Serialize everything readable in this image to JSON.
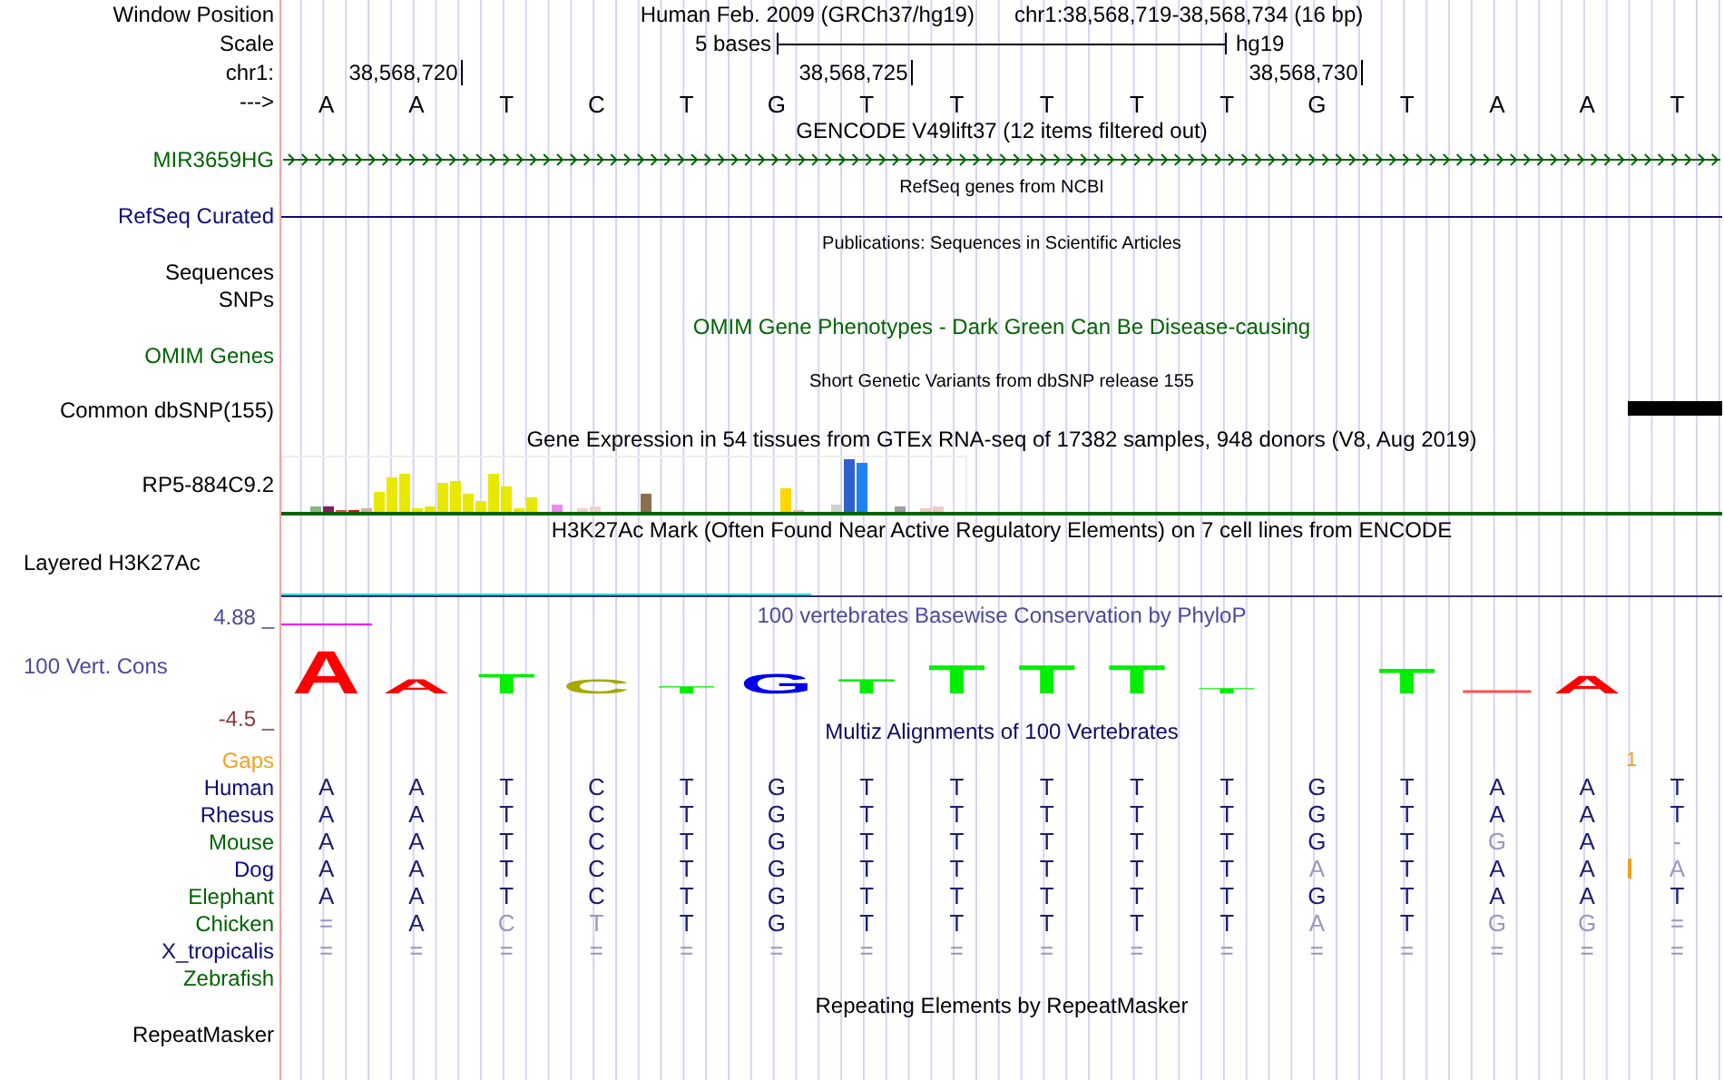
{
  "header": {
    "position_label": "Window Position",
    "assembly_title": "Human Feb. 2009 (GRCh37/hg19)",
    "position": "chr1:38,568,719-38,568,734 (16 bp)",
    "scale_label": "Scale",
    "scale_text": "5 bases",
    "assembly": "hg19",
    "chrom_label": "chr1:",
    "ticks": [
      "38,568,720",
      "38,568,725",
      "38,568,730"
    ],
    "strand_label": "--->",
    "bases": [
      "A",
      "A",
      "T",
      "C",
      "T",
      "G",
      "T",
      "T",
      "T",
      "T",
      "T",
      "G",
      "T",
      "A",
      "A",
      "T"
    ]
  },
  "rows": [
    {
      "kind": "title",
      "text": "GENCODE V49lift37 (12 items filtered out)",
      "color": "#000000"
    },
    {
      "kind": "gene",
      "label": "MIR3659HG",
      "color": "#006400"
    },
    {
      "kind": "subtitle",
      "text": "RefSeq genes from NCBI",
      "color": "#000000"
    },
    {
      "kind": "line",
      "label": "RefSeq Curated",
      "color": "#0c0c78"
    },
    {
      "kind": "subtitle",
      "text": "Publications: Sequences in Scientific Articles",
      "color": "#000000"
    },
    {
      "kind": "label",
      "label": "Sequences",
      "color": "#000000"
    },
    {
      "kind": "label",
      "label": "SNPs",
      "color": "#000000"
    },
    {
      "kind": "title",
      "text": "OMIM Gene Phenotypes - Dark Green Can Be Disease-causing",
      "color": "#006400"
    },
    {
      "kind": "label",
      "label": "OMIM Genes",
      "color": "#006400"
    },
    {
      "kind": "subtitle",
      "text": "Short Genetic Variants from dbSNP release 155",
      "color": "#000000"
    },
    {
      "kind": "variants",
      "label": "Common dbSNP(155)",
      "color": "#000000"
    },
    {
      "kind": "title",
      "text": "Gene Expression in 54 tissues from GTEx RNA-seq of 17382 samples, 948 donors (V8, Aug 2019)",
      "color": "#000000"
    },
    {
      "kind": "expression",
      "label": "RP5-884C9.2",
      "color": "#000000"
    },
    {
      "kind": "title",
      "text": "H3K27Ac Mark (Often Found Near Active Regulatory Elements) on 7 cell lines from ENCODE",
      "color": "#000000"
    },
    {
      "kind": "layered",
      "label": "Layered H3K27Ac",
      "color": "#000000"
    },
    {
      "kind": "phylop",
      "label": "100 Vert. Cons",
      "color": "#4a4a9a",
      "max": "4.88 _",
      "min": "-4.5 _",
      "text": "100 vertebrates Basewise Conservation by PhyloP",
      "logo": [
        {
          "letter": "A",
          "color": "#ff0000"
        },
        {
          "letter": "A",
          "color": "#ff0000"
        },
        {
          "letter": "T",
          "color": "#00ee00"
        },
        {
          "letter": "C",
          "color": "#a8a800"
        },
        {
          "letter": "T",
          "color": "#00ee00"
        },
        {
          "letter": "G",
          "color": "#0000ee"
        },
        {
          "letter": "T",
          "color": "#00ee00"
        },
        {
          "letter": "T",
          "color": "#00ee00"
        },
        {
          "letter": "T",
          "color": "#00ee00"
        },
        {
          "letter": "T",
          "color": "#00ee00"
        },
        {
          "letter": "T",
          "color": "#00ee00"
        },
        {
          "letter": "T",
          "color": "#00ee00"
        },
        {
          "letter": "A",
          "color": "#ff0000"
        }
      ]
    },
    {
      "kind": "title",
      "text": "Multiz Alignments of 100 Vertebrates",
      "color": "#0c0c60"
    },
    {
      "kind": "gaps",
      "label": "Gaps",
      "color": "#f0a020",
      "count": "1"
    },
    {
      "kind": "species",
      "label": "Human",
      "color": "#0c0c78",
      "bases": [
        {
          "text": "A",
          "dim": false
        },
        {
          "text": "A",
          "dim": false
        },
        {
          "text": "T",
          "dim": false
        },
        {
          "text": "C",
          "dim": false
        },
        {
          "text": "T",
          "dim": false
        },
        {
          "text": "G",
          "dim": false
        },
        {
          "text": "T",
          "dim": false
        },
        {
          "text": "T",
          "dim": false
        },
        {
          "text": "T",
          "dim": false
        },
        {
          "text": "T",
          "dim": false
        },
        {
          "text": "T",
          "dim": false
        },
        {
          "text": "G",
          "dim": false
        },
        {
          "text": "T",
          "dim": false
        },
        {
          "text": "A",
          "dim": false
        },
        {
          "text": "A",
          "dim": false
        },
        {
          "text": "T",
          "dim": false
        }
      ]
    },
    {
      "kind": "species",
      "label": "Rhesus",
      "color": "#0c0c78",
      "bases": [
        {
          "text": "A",
          "dim": false
        },
        {
          "text": "A",
          "dim": false
        },
        {
          "text": "T",
          "dim": false
        },
        {
          "text": "C",
          "dim": false
        },
        {
          "text": "T",
          "dim": false
        },
        {
          "text": "G",
          "dim": false
        },
        {
          "text": "T",
          "dim": false
        },
        {
          "text": "T",
          "dim": false
        },
        {
          "text": "T",
          "dim": false
        },
        {
          "text": "T",
          "dim": false
        },
        {
          "text": "T",
          "dim": false
        },
        {
          "text": "G",
          "dim": false
        },
        {
          "text": "T",
          "dim": false
        },
        {
          "text": "A",
          "dim": false
        },
        {
          "text": "A",
          "dim": false
        },
        {
          "text": "T",
          "dim": false
        }
      ]
    },
    {
      "kind": "species",
      "label": "Mouse",
      "color": "#006400",
      "bases": [
        {
          "text": "A",
          "dim": false
        },
        {
          "text": "A",
          "dim": false
        },
        {
          "text": "T",
          "dim": false
        },
        {
          "text": "C",
          "dim": false
        },
        {
          "text": "T",
          "dim": false
        },
        {
          "text": "G",
          "dim": false
        },
        {
          "text": "T",
          "dim": false
        },
        {
          "text": "T",
          "dim": false
        },
        {
          "text": "T",
          "dim": false
        },
        {
          "text": "T",
          "dim": false
        },
        {
          "text": "T",
          "dim": false
        },
        {
          "text": "G",
          "dim": false
        },
        {
          "text": "T",
          "dim": false
        },
        {
          "text": "G",
          "dim": true
        },
        {
          "text": "A",
          "dim": false
        },
        {
          "text": "-",
          "dim": true
        }
      ]
    },
    {
      "kind": "species",
      "label": "Dog",
      "color": "#0c0c78",
      "insertion": true,
      "bases": [
        {
          "text": "A",
          "dim": false
        },
        {
          "text": "A",
          "dim": false
        },
        {
          "text": "T",
          "dim": false
        },
        {
          "text": "C",
          "dim": false
        },
        {
          "text": "T",
          "dim": false
        },
        {
          "text": "G",
          "dim": false
        },
        {
          "text": "T",
          "dim": false
        },
        {
          "text": "T",
          "dim": false
        },
        {
          "text": "T",
          "dim": false
        },
        {
          "text": "T",
          "dim": false
        },
        {
          "text": "T",
          "dim": false
        },
        {
          "text": "A",
          "dim": true
        },
        {
          "text": "T",
          "dim": false
        },
        {
          "text": "A",
          "dim": false
        },
        {
          "text": "A",
          "dim": false
        },
        {
          "text": "A",
          "dim": true
        }
      ]
    },
    {
      "kind": "species",
      "label": "Elephant",
      "color": "#006400",
      "bases": [
        {
          "text": "A",
          "dim": false
        },
        {
          "text": "A",
          "dim": false
        },
        {
          "text": "T",
          "dim": false
        },
        {
          "text": "C",
          "dim": false
        },
        {
          "text": "T",
          "dim": false
        },
        {
          "text": "G",
          "dim": false
        },
        {
          "text": "T",
          "dim": false
        },
        {
          "text": "T",
          "dim": false
        },
        {
          "text": "T",
          "dim": false
        },
        {
          "text": "T",
          "dim": false
        },
        {
          "text": "T",
          "dim": false
        },
        {
          "text": "G",
          "dim": false
        },
        {
          "text": "T",
          "dim": false
        },
        {
          "text": "A",
          "dim": false
        },
        {
          "text": "A",
          "dim": false
        },
        {
          "text": "T",
          "dim": false
        }
      ]
    },
    {
      "kind": "species",
      "label": "Chicken",
      "color": "#006400",
      "bases": [
        {
          "text": "=",
          "dim": true
        },
        {
          "text": "A",
          "dim": false
        },
        {
          "text": "C",
          "dim": true
        },
        {
          "text": "T",
          "dim": true
        },
        {
          "text": "T",
          "dim": false
        },
        {
          "text": "G",
          "dim": false
        },
        {
          "text": "T",
          "dim": false
        },
        {
          "text": "T",
          "dim": false
        },
        {
          "text": "T",
          "dim": false
        },
        {
          "text": "T",
          "dim": false
        },
        {
          "text": "T",
          "dim": false
        },
        {
          "text": "A",
          "dim": true
        },
        {
          "text": "T",
          "dim": false
        },
        {
          "text": "G",
          "dim": true
        },
        {
          "text": "G",
          "dim": true
        },
        {
          "text": "=",
          "dim": true
        }
      ]
    },
    {
      "kind": "species",
      "label": "X_tropicalis",
      "color": "#0c0c78",
      "bases": [
        {
          "text": "=",
          "dim": true
        },
        {
          "text": "=",
          "dim": true
        },
        {
          "text": "=",
          "dim": true
        },
        {
          "text": "=",
          "dim": true
        },
        {
          "text": "=",
          "dim": true
        },
        {
          "text": "=",
          "dim": true
        },
        {
          "text": "=",
          "dim": true
        },
        {
          "text": "=",
          "dim": true
        },
        {
          "text": "=",
          "dim": true
        },
        {
          "text": "=",
          "dim": true
        },
        {
          "text": "=",
          "dim": true
        },
        {
          "text": "=",
          "dim": true
        },
        {
          "text": "=",
          "dim": true
        },
        {
          "text": "=",
          "dim": true
        },
        {
          "text": "=",
          "dim": true
        },
        {
          "text": "=",
          "dim": true
        }
      ]
    },
    {
      "kind": "species",
      "label": "Zebrafish",
      "color": "#006400"
    },
    {
      "kind": "title",
      "text": "Repeating Elements by RepeatMasker",
      "color": "#000000"
    },
    {
      "kind": "label",
      "label": "RepeatMasker",
      "color": "#000000"
    }
  ]
}
